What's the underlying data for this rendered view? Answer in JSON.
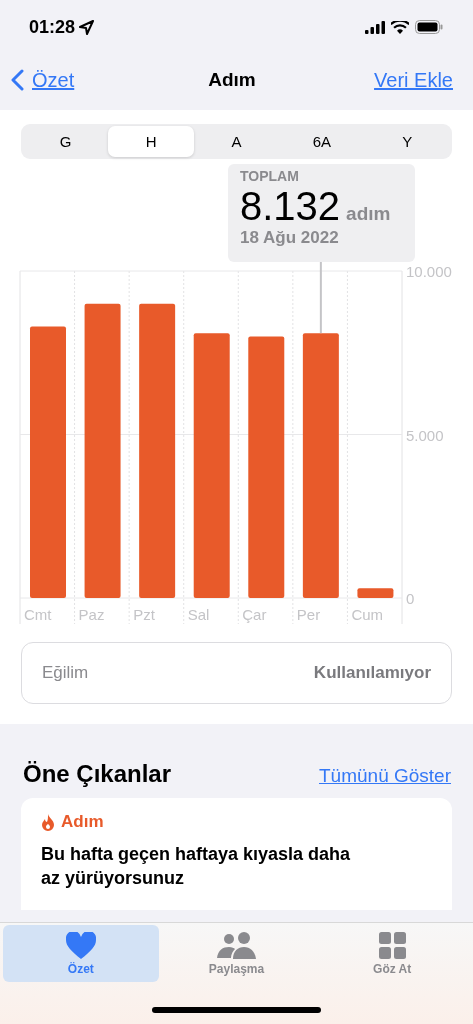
{
  "status_bar": {
    "time": "01:28"
  },
  "nav": {
    "back": "Özet",
    "title": "Adım",
    "action": "Veri Ekle"
  },
  "segments": [
    {
      "label": "G",
      "selected": false
    },
    {
      "label": "H",
      "selected": true
    },
    {
      "label": "A",
      "selected": false
    },
    {
      "label": "6A",
      "selected": false
    },
    {
      "label": "Y",
      "selected": false
    }
  ],
  "tooltip": {
    "label": "TOPLAM",
    "value": "8.132",
    "unit": "adım",
    "date": "18 Ağu 2022"
  },
  "chart": {
    "chart_data": {
      "type": "bar",
      "categories": [
        "Cmt",
        "Paz",
        "Pzt",
        "Sal",
        "Çar",
        "Per",
        "Cum"
      ],
      "values": [
        8300,
        9000,
        9000,
        8100,
        8000,
        8100,
        300
      ],
      "ylim": [
        0,
        10000
      ],
      "yticks": [
        {
          "value": 0,
          "label": "0"
        },
        {
          "value": 5000,
          "label": "5.000"
        },
        {
          "value": 10000,
          "label": "10.000"
        }
      ]
    }
  },
  "trend": {
    "label": "Eğilim",
    "value": "Kullanılamıyor"
  },
  "highlights": {
    "title": "Öne Çıkanlar",
    "link": "Tümünü Göster",
    "card": {
      "category": "Adım",
      "text": "Bu hafta geçen haftaya kıyasla daha az yürüyorsunuz"
    }
  },
  "tab_bar": [
    {
      "label": "Özet",
      "selected": true
    },
    {
      "label": "Paylaşma",
      "selected": false
    },
    {
      "label": "Göz At",
      "selected": false
    }
  ]
}
